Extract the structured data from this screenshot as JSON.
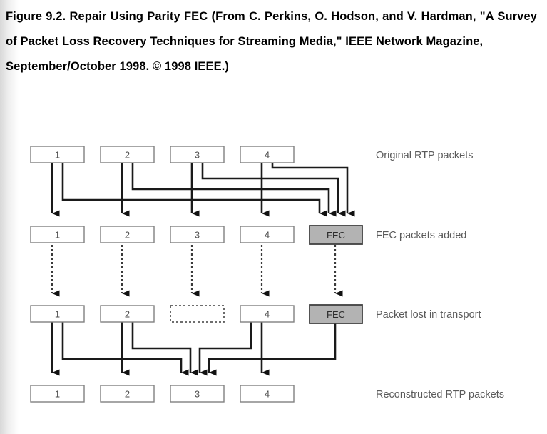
{
  "caption": {
    "line1": "Figure 9.2. Repair Using Parity FEC (From C. Perkins, O.",
    "line2": "Hodson, and V. Hardman, \"A Survey of Packet Loss Recovery",
    "line3": "Techniques for Streaming Media,\" IEEE Network Magazine,",
    "line4": "September/October 1998. © 1998 IEEE.)"
  },
  "figure": {
    "rows": [
      {
        "id": "original",
        "label": "Original RTP packets",
        "boxes": [
          {
            "text": "1",
            "kind": "packet"
          },
          {
            "text": "2",
            "kind": "packet"
          },
          {
            "text": "3",
            "kind": "packet"
          },
          {
            "text": "4",
            "kind": "packet"
          }
        ]
      },
      {
        "id": "fec-added",
        "label": "FEC packets added",
        "boxes": [
          {
            "text": "1",
            "kind": "packet"
          },
          {
            "text": "2",
            "kind": "packet"
          },
          {
            "text": "3",
            "kind": "packet"
          },
          {
            "text": "4",
            "kind": "packet"
          },
          {
            "text": "FEC",
            "kind": "fec"
          }
        ]
      },
      {
        "id": "transport-loss",
        "label": "Packet lost in transport",
        "boxes": [
          {
            "text": "1",
            "kind": "packet"
          },
          {
            "text": "2",
            "kind": "packet"
          },
          {
            "text": "",
            "kind": "lost"
          },
          {
            "text": "4",
            "kind": "packet"
          },
          {
            "text": "FEC",
            "kind": "fec"
          }
        ]
      },
      {
        "id": "reconstructed",
        "label": "Reconstructed RTP packets",
        "boxes": [
          {
            "text": "1",
            "kind": "packet"
          },
          {
            "text": "2",
            "kind": "packet"
          },
          {
            "text": "3",
            "kind": "packet"
          },
          {
            "text": "4",
            "kind": "packet"
          }
        ]
      }
    ],
    "colors": {
      "fec_fill": "#b3b3b3",
      "box_stroke": "#808080",
      "fec_stroke": "#404040",
      "line": "#1a1a1a",
      "label_text": "#5a5a5a",
      "box_text": "#4a4a4a"
    }
  }
}
